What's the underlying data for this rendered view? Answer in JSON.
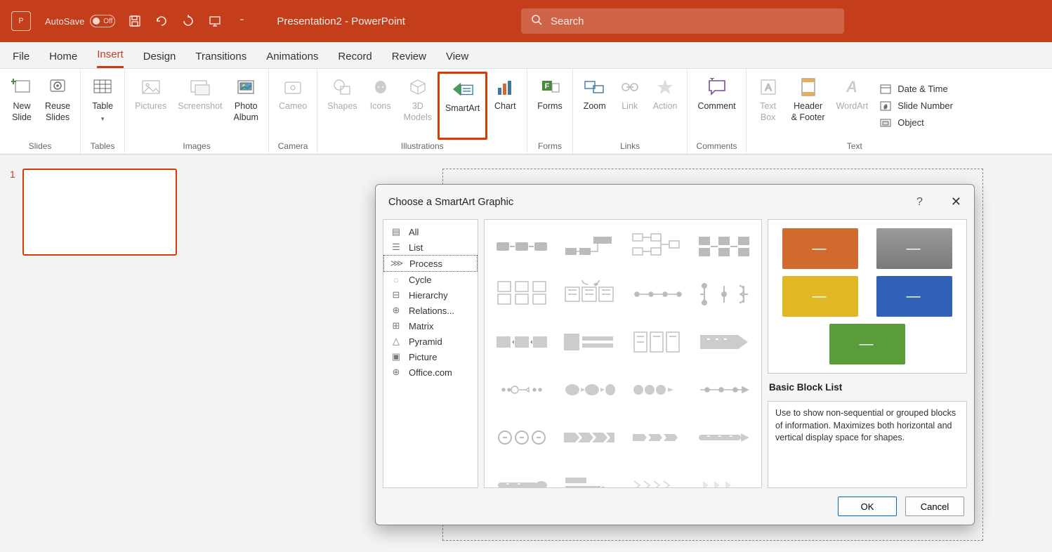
{
  "titlebar": {
    "autosave_label": "AutoSave",
    "autosave_state": "Off",
    "doc_title": "Presentation2  -  PowerPoint",
    "search_placeholder": "Search"
  },
  "menu": {
    "items": [
      "File",
      "Home",
      "Insert",
      "Design",
      "Transitions",
      "Animations",
      "Record",
      "Review",
      "View"
    ],
    "active": "Insert"
  },
  "ribbon": {
    "groups": {
      "slides": {
        "label": "Slides",
        "new_slide": "New\nSlide",
        "reuse_slides": "Reuse\nSlides"
      },
      "tables": {
        "label": "Tables",
        "table": "Table"
      },
      "images": {
        "label": "Images",
        "pictures": "Pictures",
        "screenshot": "Screenshot",
        "photo_album": "Photo\nAlbum"
      },
      "camera": {
        "label": "Camera",
        "cameo": "Cameo"
      },
      "illustrations": {
        "label": "Illustrations",
        "shapes": "Shapes",
        "icons": "Icons",
        "models": "3D\nModels",
        "smartart": "SmartArt",
        "chart": "Chart"
      },
      "forms": {
        "label": "Forms",
        "forms": "Forms"
      },
      "links": {
        "label": "Links",
        "zoom": "Zoom",
        "link": "Link",
        "action": "Action"
      },
      "comments": {
        "label": "Comments",
        "comment": "Comment"
      },
      "text": {
        "label": "Text",
        "textbox": "Text\nBox",
        "header": "Header\n& Footer",
        "wordart": "WordArt",
        "datetime": "Date & Time",
        "slidenum": "Slide Number",
        "object": "Object"
      }
    }
  },
  "slide_panel": {
    "current": "1"
  },
  "dialog": {
    "title": "Choose a SmartArt Graphic",
    "help": "?",
    "categories": [
      "All",
      "List",
      "Process",
      "Cycle",
      "Hierarchy",
      "Relations...",
      "Matrix",
      "Pyramid",
      "Picture",
      "Office.com"
    ],
    "selected_category": "Process",
    "preview": {
      "title": "Basic Block List",
      "description": "Use to show non-sequential or grouped blocks of information. Maximizes both horizontal and vertical display space for shapes.",
      "colors": [
        "#d06a2f",
        "#8f8f8f",
        "#e0b724",
        "#3262b8",
        "#5a9c3a"
      ]
    },
    "buttons": {
      "ok": "OK",
      "cancel": "Cancel"
    }
  }
}
